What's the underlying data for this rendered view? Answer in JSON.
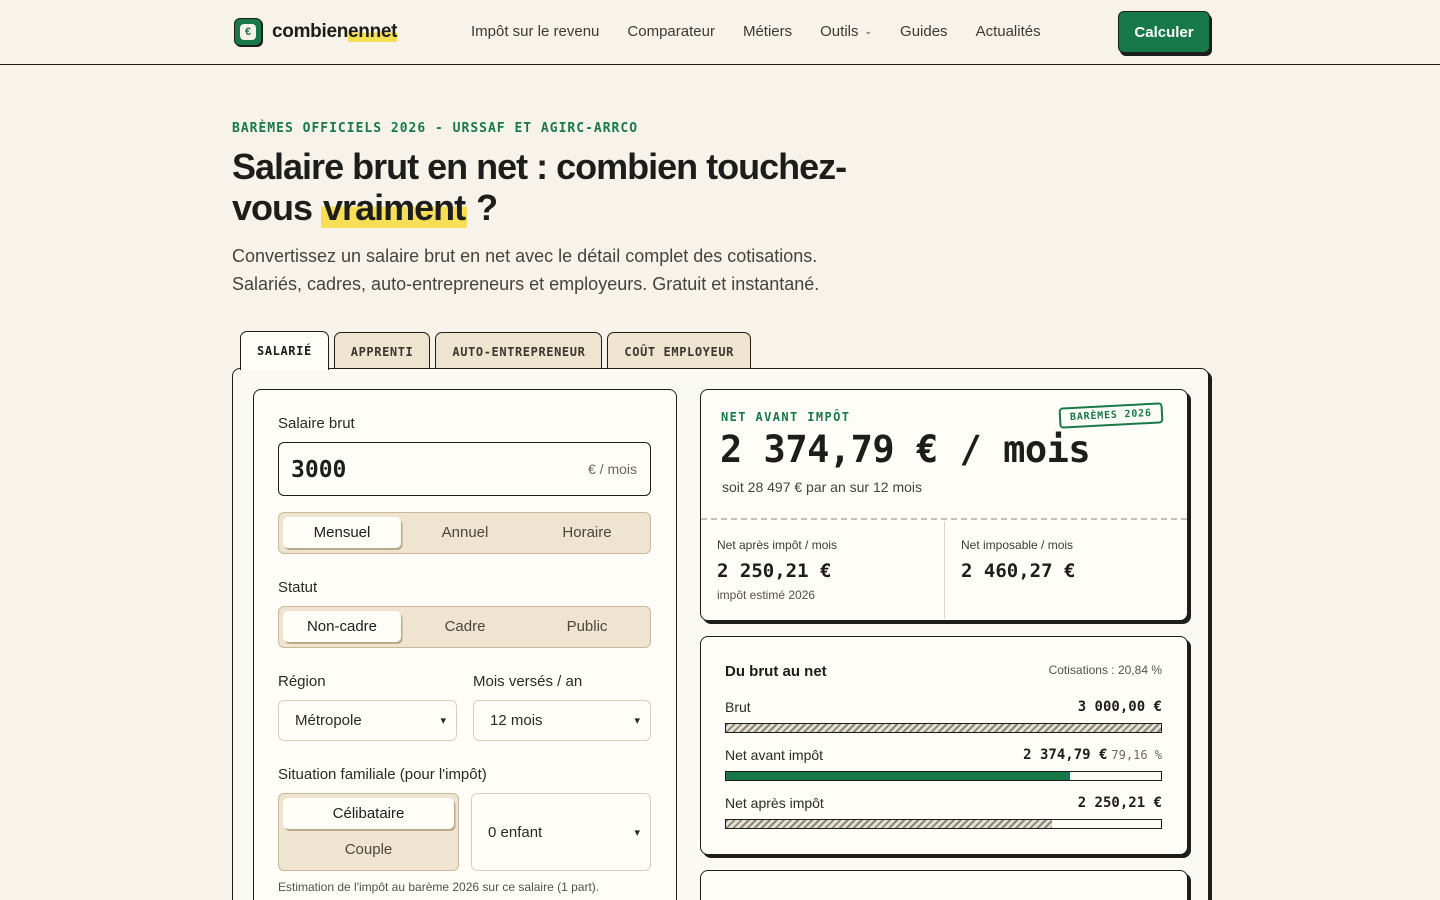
{
  "header": {
    "logo_icon": "euro-icon",
    "logo_main": "combien",
    "logo_hl": "ennet",
    "nav": [
      "Impôt sur le revenu",
      "Comparateur",
      "Métiers",
      "Outils",
      "Guides",
      "Actualités"
    ],
    "cta": "Calculer"
  },
  "hero": {
    "eyebrow": "BARÈMES OFFICIELS 2026 - URSSAF ET AGIRC-ARRCO",
    "title_a": "Salaire brut en net : combien touchez-vous ",
    "title_hl": "vraiment",
    "title_b": " ?",
    "lead": "Convertissez un salaire brut en net avec le détail complet des cotisations. Salariés, cadres, auto-entrepreneurs et employeurs. Gratuit et instantané."
  },
  "tabs": [
    "SALARIÉ",
    "APPRENTI",
    "AUTO-ENTREPRENEUR",
    "COÛT EMPLOYEUR"
  ],
  "form": {
    "brut_label": "Salaire brut",
    "brut_value": "3000",
    "brut_unit": "€ / mois",
    "period": [
      "Mensuel",
      "Annuel",
      "Horaire"
    ],
    "statut_label": "Statut",
    "statut": [
      "Non-cadre",
      "Cadre",
      "Public"
    ],
    "region_label": "Région",
    "region_value": "Métropole",
    "mois_label": "Mois versés / an",
    "mois_value": "12 mois",
    "famille_label": "Situation familiale (pour l'impôt)",
    "famille": [
      "Célibataire",
      "Couple"
    ],
    "enfants_value": "0 enfant",
    "note": "Estimation de l'impôt au barème 2026 sur ce salaire (1 part)."
  },
  "result": {
    "eyebrow": "NET AVANT IMPÔT",
    "stamp": "BARÈMES 2026",
    "main": "2 374,79 € / mois",
    "sub": "soit 28 497 € par an sur 12 mois",
    "apres_label": "Net après impôt / mois",
    "apres_value": "2 250,21 €",
    "apres_hint": "impôt estimé 2026",
    "imposable_label": "Net imposable / mois",
    "imposable_value": "2 460,27 €"
  },
  "breakdown": {
    "title": "Du brut au net",
    "meta": "Cotisations : 20,84 %",
    "rows": [
      {
        "label": "Brut",
        "value": "3 000,00 €",
        "pct": "",
        "fill": 1.0
      },
      {
        "label": "Net avant impôt",
        "value": "2 374,79 €",
        "pct": "79,16 %",
        "fill": 0.7916
      },
      {
        "label": "Net après impôt",
        "value": "2 250,21 €",
        "pct": "",
        "fill": 0.75
      }
    ]
  },
  "colors": {
    "accent": "#17784a",
    "highlight": "#f6df56",
    "background": "#f7f3ea"
  }
}
